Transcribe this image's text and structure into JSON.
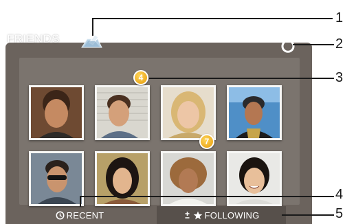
{
  "widget": {
    "title": "FRIENDS"
  },
  "photos": [
    {
      "badge": null
    },
    {
      "badge": "4"
    },
    {
      "badge": null
    },
    {
      "badge": null
    },
    {
      "badge": null
    },
    {
      "badge": null
    },
    {
      "badge": "7"
    },
    {
      "badge": null
    }
  ],
  "tabs": {
    "recent_label": "RECENT",
    "following_label": "FOLLOWING"
  },
  "callouts": [
    "1",
    "2",
    "3",
    "4",
    "5"
  ],
  "colors": {
    "panel": "#6b635d",
    "tab_selected": "#57504b",
    "badge": "#f0a81c"
  },
  "icons": [
    "share-icon",
    "refresh-icon",
    "clock-icon",
    "plus-minus-icon",
    "star-icon"
  ]
}
